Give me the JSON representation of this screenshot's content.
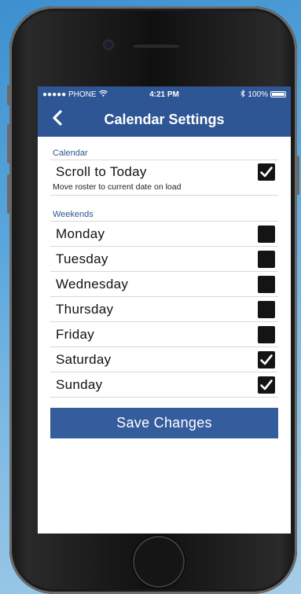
{
  "status_bar": {
    "carrier": "●●●●● PHONE",
    "time": "4:21 PM",
    "battery": "100%"
  },
  "nav": {
    "title": "Calendar Settings",
    "back_icon": "chevron-left-icon"
  },
  "calendar_section": {
    "header": "Calendar",
    "scroll_to_today": {
      "label": "Scroll to Today",
      "subtitle": "Move roster to current date on load",
      "checked": true
    }
  },
  "weekends_section": {
    "header": "Weekends",
    "days": [
      {
        "label": "Monday",
        "checked": false
      },
      {
        "label": "Tuesday",
        "checked": false
      },
      {
        "label": "Wednesday",
        "checked": false
      },
      {
        "label": "Thursday",
        "checked": false
      },
      {
        "label": "Friday",
        "checked": false
      },
      {
        "label": "Saturday",
        "checked": true
      },
      {
        "label": "Sunday",
        "checked": true
      }
    ]
  },
  "save_button": {
    "label": "Save Changes"
  },
  "colors": {
    "accent": "#2e5594",
    "button": "#355d9e",
    "checkbox": "#141414"
  }
}
